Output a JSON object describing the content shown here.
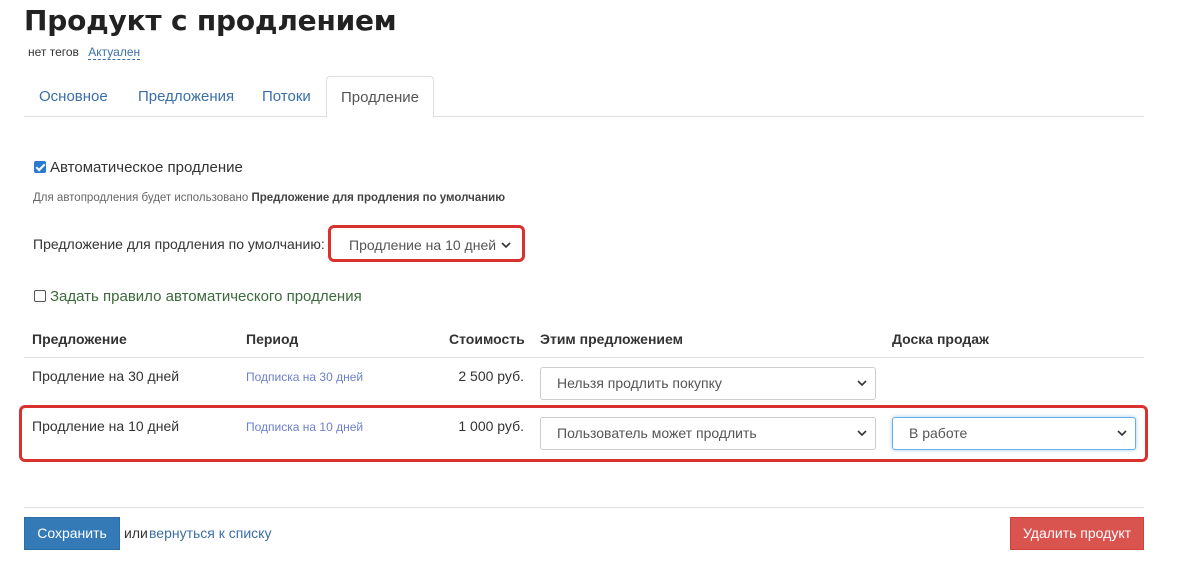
{
  "page": {
    "title": "Продукт с продлением",
    "tags": "нет тегов",
    "status": "Актуален"
  },
  "tabs": [
    {
      "label": "Основное"
    },
    {
      "label": "Предложения"
    },
    {
      "label": "Потоки"
    },
    {
      "label": "Продление",
      "active": true
    }
  ],
  "renewal": {
    "auto_checked": true,
    "auto_label": "Автоматическое продление",
    "hint_prefix": "Для автопродления будет использовано",
    "hint_bold": "Предложение для продления по умолчанию",
    "default_offer_label": "Предложение для продления по умолчанию:",
    "default_offer_value": "Продление на 10 дней",
    "rule_checked": false,
    "rule_label": "Задать правило автоматического продления"
  },
  "table": {
    "headers": [
      "Предложение",
      "Период",
      "Стоимость",
      "Этим предложением",
      "Доска продаж"
    ],
    "rows": [
      {
        "offer": "Продление на 30 дней",
        "period": "Подписка на 30 дней",
        "price": "2 500 руб.",
        "action": "Нельзя продлить покупку",
        "board": ""
      },
      {
        "offer": "Продление на 10 дней",
        "period": "Подписка на 10 дней",
        "price": "1 000 руб.",
        "action": "Пользователь может продлить",
        "board": "В работе"
      }
    ]
  },
  "footer": {
    "save_label": "Сохранить",
    "or_text": "или",
    "back_label": "вернуться к списку",
    "delete_label": "Удалить продукт"
  },
  "icons": {
    "select_arrow": "chevron-down-icon"
  },
  "colors": {
    "link": "#3a6fa8",
    "primary": "#337ab7",
    "danger": "#d9534f",
    "highlight": "#d9322e"
  }
}
